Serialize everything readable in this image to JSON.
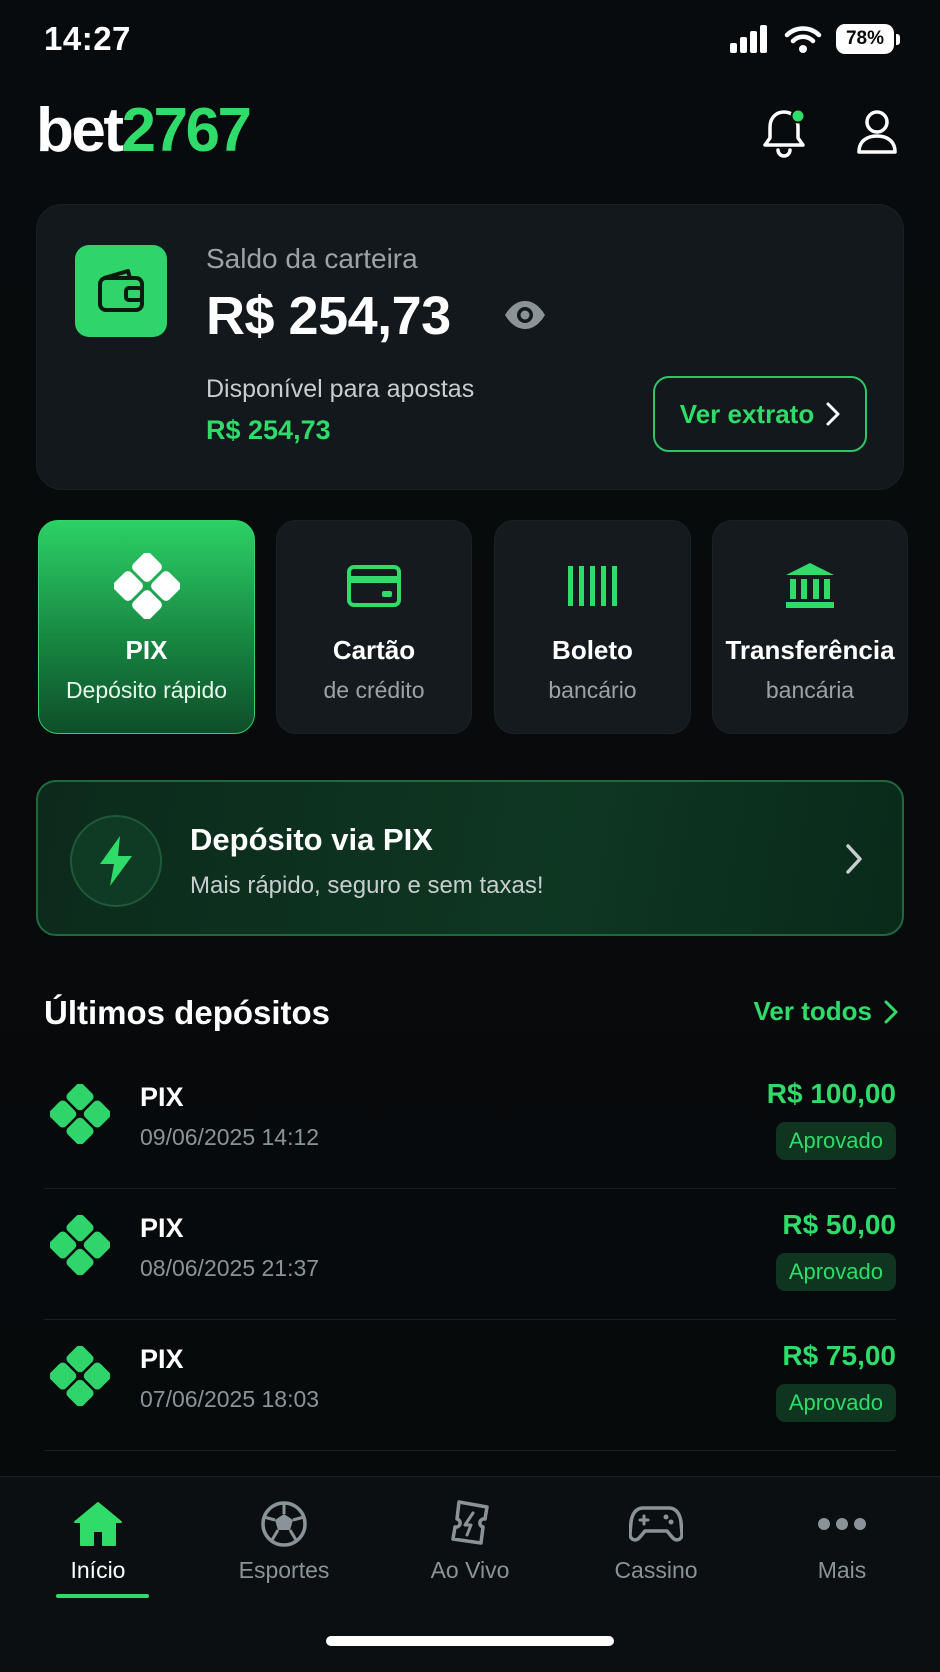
{
  "status_bar": {
    "time": "14:27",
    "battery": "78%"
  },
  "header": {
    "logo_part1": "bet",
    "logo_part2": "2767"
  },
  "wallet": {
    "label": "Saldo da carteira",
    "balance": "R$ 254,73",
    "available_label": "Disponível para apostas",
    "available_value": "R$ 254,73",
    "statement_button": "Ver extrato"
  },
  "methods": [
    {
      "title": "PIX",
      "subtitle": "Depósito rápido"
    },
    {
      "title": "Cartão",
      "subtitle": "de crédito"
    },
    {
      "title": "Boleto",
      "subtitle": "bancário"
    },
    {
      "title": "Transferência",
      "subtitle": "bancária"
    }
  ],
  "pix_banner": {
    "title": "Depósito via PIX",
    "subtitle": "Mais rápido, seguro e sem taxas!"
  },
  "recent": {
    "title": "Últimos depósitos",
    "see_all": "Ver todos",
    "items": [
      {
        "method": "PIX",
        "date": "09/06/2025 14:12",
        "amount": "R$ 100,00",
        "status": "Aprovado"
      },
      {
        "method": "PIX",
        "date": "08/06/2025 21:37",
        "amount": "R$ 50,00",
        "status": "Aprovado"
      },
      {
        "method": "PIX",
        "date": "07/06/2025 18:03",
        "amount": "R$ 75,00",
        "status": "Aprovado"
      }
    ]
  },
  "nav": [
    {
      "label": "Início",
      "icon": "home-icon"
    },
    {
      "label": "Esportes",
      "icon": "soccer-ball-icon"
    },
    {
      "label": "Ao Vivo",
      "icon": "live-ticket-icon"
    },
    {
      "label": "Cassino",
      "icon": "gamepad-icon"
    },
    {
      "label": "Mais",
      "icon": "more-icon"
    }
  ],
  "colors": {
    "accent": "#2fdc6a",
    "background": "#07090b",
    "card": "#12181b"
  }
}
